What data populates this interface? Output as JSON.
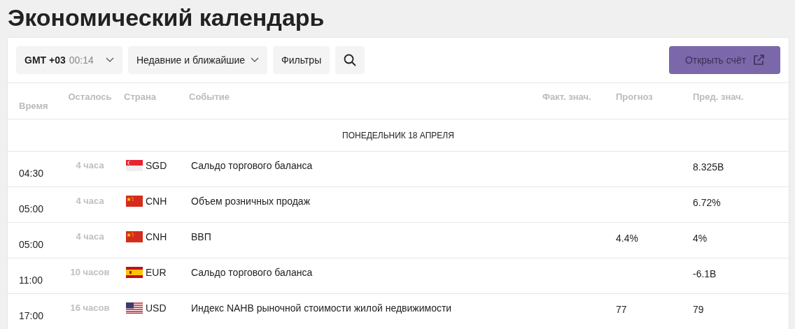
{
  "title": "Экономический календарь",
  "toolbar": {
    "timezone": "GMT +03",
    "clock": "00:14",
    "period": "Недавние и ближайшие",
    "filters": "Фильтры",
    "open_account": "Открыть счёт"
  },
  "table": {
    "columns": [
      "Время",
      "Осталось",
      "Страна",
      "Событие",
      "Факт. знач.",
      "Прогноз",
      "Пред. знач."
    ],
    "day": "ПОНЕДЕЛЬНИК 18 АПРЕЛЯ",
    "rows": [
      {
        "time": "04:30",
        "remaining": "4 часа",
        "kind": "sg",
        "currency": "SGD",
        "event": "Сальдо торгового баланса",
        "previous": "8.325B"
      },
      {
        "time": "05:00",
        "remaining": "4 часа",
        "kind": "cn",
        "currency": "CNH",
        "event": "Объем розничных продаж",
        "previous": "6.72%"
      },
      {
        "time": "05:00",
        "remaining": "4 часа",
        "kind": "cn",
        "currency": "CNH",
        "event": "ВВП",
        "forecast": "4.4%",
        "previous": "4%"
      },
      {
        "time": "11:00",
        "remaining": "10 часов",
        "kind": "es",
        "currency": "EUR",
        "event": "Сальдо торгового баланса",
        "previous": "-6.1B"
      },
      {
        "time": "17:00",
        "remaining": "16 часов",
        "kind": "us",
        "currency": "USD",
        "event": "Индекс NAHB рыночной стоимости жилой недвижимости",
        "forecast": "77",
        "previous": "79"
      }
    ]
  }
}
